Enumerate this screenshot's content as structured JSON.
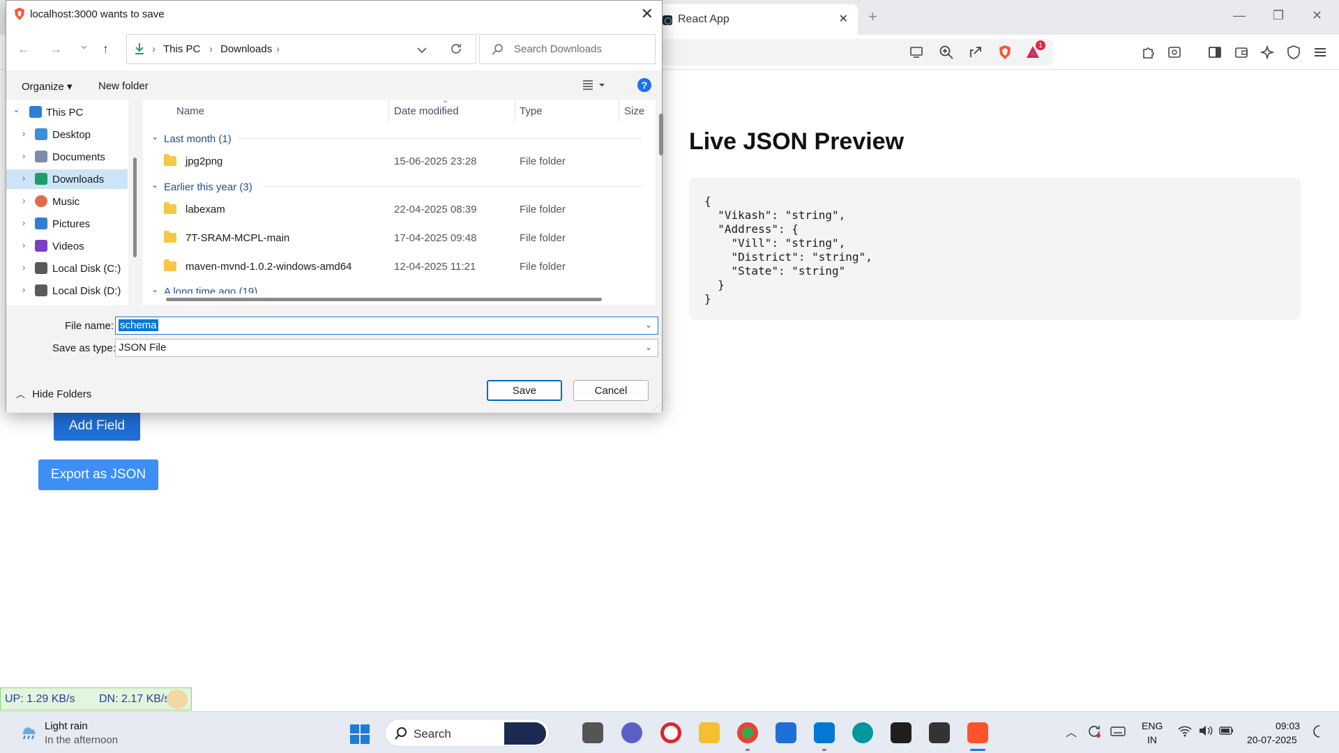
{
  "browser": {
    "tab_title": "React App",
    "tab_close": "✕",
    "new_tab": "+",
    "window_min": "—",
    "window_restore": "❐",
    "window_close": "✕",
    "badge_count": "1"
  },
  "page": {
    "preview_title": "Live JSON Preview",
    "json_text": "{\n  \"Vikash\": \"string\",\n  \"Address\": {\n    \"Vill\": \"string\",\n    \"District\": \"string\",\n    \"State\": \"string\"\n  }\n}",
    "add_field_label": "Add Field",
    "export_label": "Export as JSON"
  },
  "dialog": {
    "title": "localhost:3000 wants to save",
    "close": "✕",
    "nav": {
      "back": "←",
      "forward": "→",
      "recent": "⌄",
      "up": "↑"
    },
    "breadcrumb": [
      "This PC",
      "Downloads"
    ],
    "search_placeholder": "Search Downloads",
    "organize_label": "Organize ▾",
    "new_folder_label": "New folder",
    "help": "?",
    "tree": [
      {
        "label": "This PC",
        "icon": "computer-icon",
        "color": "#2d7fd3"
      },
      {
        "label": "Desktop",
        "icon": "desktop-icon",
        "color": "#3d8ed8"
      },
      {
        "label": "Documents",
        "icon": "documents-icon",
        "color": "#7d8ca8"
      },
      {
        "label": "Downloads",
        "icon": "downloads-icon",
        "color": "#1a9e6a"
      },
      {
        "label": "Music",
        "icon": "music-icon",
        "color": "#e06a4a"
      },
      {
        "label": "Pictures",
        "icon": "pictures-icon",
        "color": "#2f7fd0"
      },
      {
        "label": "Videos",
        "icon": "videos-icon",
        "color": "#7b3fc4"
      },
      {
        "label": "Local Disk (C:)",
        "icon": "disk-icon",
        "color": "#5a5a5a"
      },
      {
        "label": "Local Disk (D:)",
        "icon": "disk-icon",
        "color": "#5a5a5a"
      }
    ],
    "columns": [
      "Name",
      "Date modified",
      "Type",
      "Size"
    ],
    "groups": [
      {
        "label": "Last month (1)"
      },
      {
        "label": "Earlier this year (3)"
      },
      {
        "label": "A long time ago (19)"
      }
    ],
    "files": [
      {
        "name": "jpg2png",
        "date": "15-06-2025 23:28",
        "type": "File folder"
      },
      {
        "name": "labexam",
        "date": "22-04-2025 08:39",
        "type": "File folder"
      },
      {
        "name": "7T-SRAM-MCPL-main",
        "date": "17-04-2025 09:48",
        "type": "File folder"
      },
      {
        "name": "maven-mvnd-1.0.2-windows-amd64",
        "date": "12-04-2025 11:21",
        "type": "File folder"
      }
    ],
    "file_name_label": "File name:",
    "file_name_value": "schema",
    "save_type_label": "Save as type:",
    "save_type_value": "JSON File",
    "hide_folders_label": "Hide Folders",
    "save_label": "Save",
    "cancel_label": "Cancel"
  },
  "netspeed": {
    "up": "UP: 1.29 KB/s",
    "down": "DN: 2.17 KB/s"
  },
  "taskbar": {
    "weather_title": "Light rain",
    "weather_sub": "In the afternoon",
    "search_placeholder": "Search",
    "lang_line1": "ENG",
    "lang_line2": "IN",
    "time": "09:03",
    "date": "20-07-2025"
  }
}
